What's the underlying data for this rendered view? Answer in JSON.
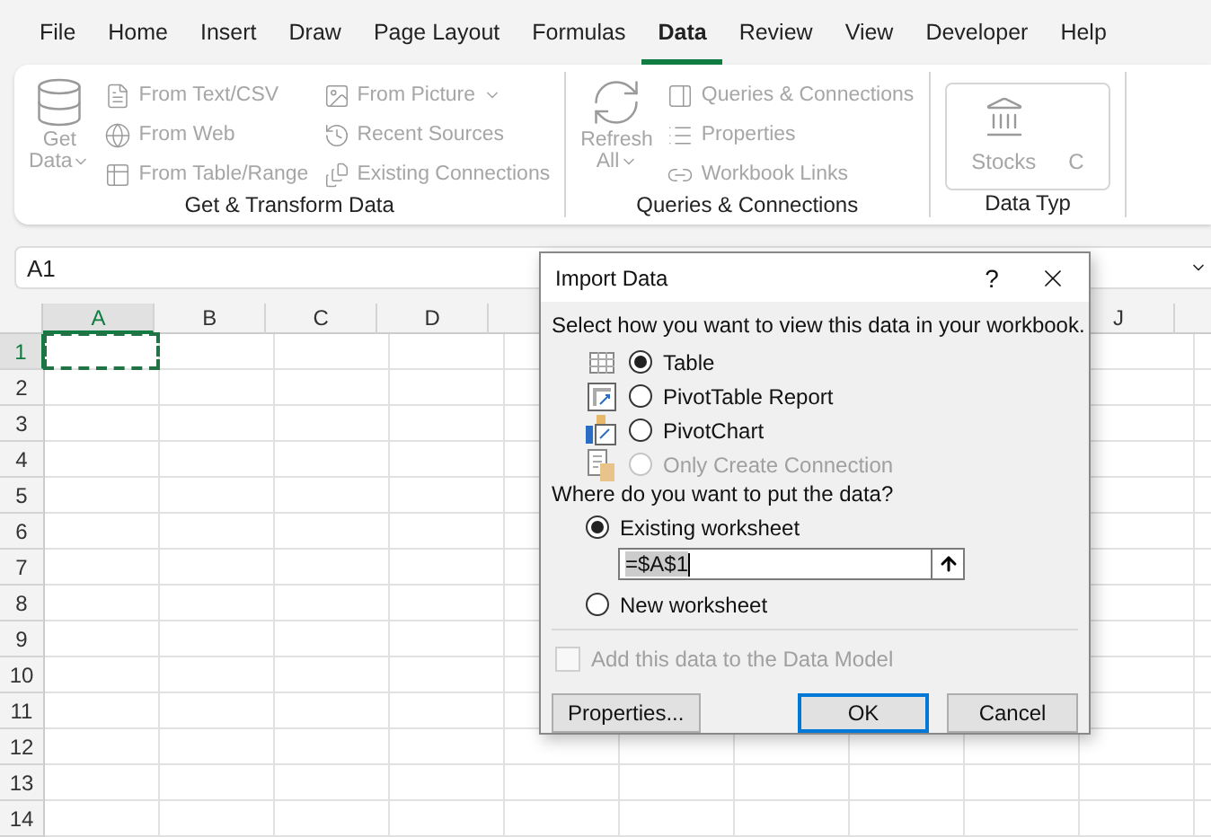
{
  "menu_tabs": [
    {
      "label": "File",
      "selected": false
    },
    {
      "label": "Home",
      "selected": false
    },
    {
      "label": "Insert",
      "selected": false
    },
    {
      "label": "Draw",
      "selected": false
    },
    {
      "label": "Page Layout",
      "selected": false
    },
    {
      "label": "Formulas",
      "selected": false
    },
    {
      "label": "Data",
      "selected": true
    },
    {
      "label": "Review",
      "selected": false
    },
    {
      "label": "View",
      "selected": false
    },
    {
      "label": "Developer",
      "selected": false
    },
    {
      "label": "Help",
      "selected": false
    }
  ],
  "ribbon": {
    "groups": [
      {
        "label": "Get & Transform Data",
        "large": {
          "lines": [
            "Get",
            "Data"
          ],
          "dropdown": true,
          "disabled": true
        },
        "columns": [
          [
            {
              "label": "From Text/CSV",
              "dropdown": false,
              "disabled": true
            },
            {
              "label": "From Web",
              "dropdown": false,
              "disabled": true
            },
            {
              "label": "From Table/Range",
              "dropdown": false,
              "disabled": true
            }
          ],
          [
            {
              "label": "From Picture",
              "dropdown": true,
              "disabled": true
            },
            {
              "label": "Recent Sources",
              "dropdown": false,
              "disabled": true
            },
            {
              "label": "Existing Connections",
              "dropdown": false,
              "disabled": true
            }
          ]
        ]
      },
      {
        "label": "Queries & Connections",
        "large": {
          "lines": [
            "Refresh",
            "All"
          ],
          "dropdown": true,
          "disabled": true
        },
        "columns": [
          [
            {
              "label": "Queries & Connections",
              "dropdown": false,
              "disabled": true
            },
            {
              "label": "Properties",
              "dropdown": false,
              "disabled": true
            },
            {
              "label": "Workbook Links",
              "dropdown": false,
              "disabled": true
            }
          ]
        ]
      },
      {
        "label": "Data Typ",
        "gallery": [
          {
            "label": "Stocks",
            "disabled": true
          },
          {
            "label": "C",
            "disabled": true
          }
        ]
      }
    ]
  },
  "name_box": {
    "value": "A1"
  },
  "columns": [
    {
      "label": "A",
      "selected": true
    },
    {
      "label": "B",
      "selected": false
    },
    {
      "label": "C",
      "selected": false
    },
    {
      "label": "D",
      "selected": false
    },
    {
      "label": "J",
      "selected": false
    }
  ],
  "rows": [
    {
      "label": "1",
      "selected": true
    },
    {
      "label": "2",
      "selected": false
    },
    {
      "label": "3",
      "selected": false
    },
    {
      "label": "4",
      "selected": false
    },
    {
      "label": "5",
      "selected": false
    },
    {
      "label": "6",
      "selected": false
    },
    {
      "label": "7",
      "selected": false
    },
    {
      "label": "8",
      "selected": false
    },
    {
      "label": "9",
      "selected": false
    },
    {
      "label": "10",
      "selected": false
    },
    {
      "label": "11",
      "selected": false
    },
    {
      "label": "12",
      "selected": false
    },
    {
      "label": "13",
      "selected": false
    },
    {
      "label": "14",
      "selected": false
    }
  ],
  "dialog": {
    "title": "Import Data",
    "help": "?",
    "view_prompt": "Select how you want to view this data in your workbook.",
    "view_options": [
      {
        "label": "Table",
        "selected": true,
        "disabled": false
      },
      {
        "label": "PivotTable Report",
        "selected": false,
        "disabled": false
      },
      {
        "label": "PivotChart",
        "selected": false,
        "disabled": false
      },
      {
        "label": "Only Create Connection",
        "selected": false,
        "disabled": true
      }
    ],
    "place_prompt": "Where do you want to put the data?",
    "place_options": [
      {
        "label": "Existing worksheet",
        "selected": true
      },
      {
        "label": "New worksheet",
        "selected": false
      }
    ],
    "range": {
      "value": "=$A$1"
    },
    "data_model": {
      "label": "Add this data to the Data Model",
      "checked": false,
      "disabled": true
    },
    "buttons": [
      {
        "label": "Properties...",
        "default": false
      },
      {
        "label": "OK",
        "default": true
      },
      {
        "label": "Cancel",
        "default": false
      }
    ]
  }
}
